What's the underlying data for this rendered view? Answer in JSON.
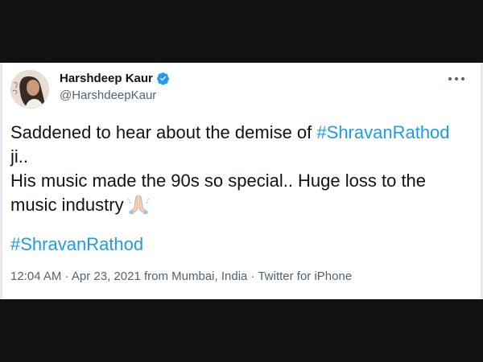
{
  "author": {
    "name": "Harshdeep Kaur",
    "handle": "@HarshdeepKaur",
    "verified_color": "#1d9bf0"
  },
  "tweet": {
    "line1_text": "Saddened to hear about the demise of ",
    "line1_hashtag": "#ShravanRathod",
    "line2_text": "ji..",
    "line3_text": "His music made the 90s so special.. Huge loss to the",
    "line4_text": "music industry",
    "emoji": "folded-hands-icon",
    "hashtag_footer": "#ShravanRathod"
  },
  "meta": {
    "time": "12:04 AM",
    "sep1": " · ",
    "date": "Apr 23, 2021",
    "location_prefix": " from ",
    "location": "Mumbai, India",
    "sep2": " · ",
    "source": "Twitter for iPhone"
  },
  "colors": {
    "link": "#1d9bf0",
    "text": "#0f1419",
    "muted": "#536471",
    "page_bg": "#111111"
  }
}
